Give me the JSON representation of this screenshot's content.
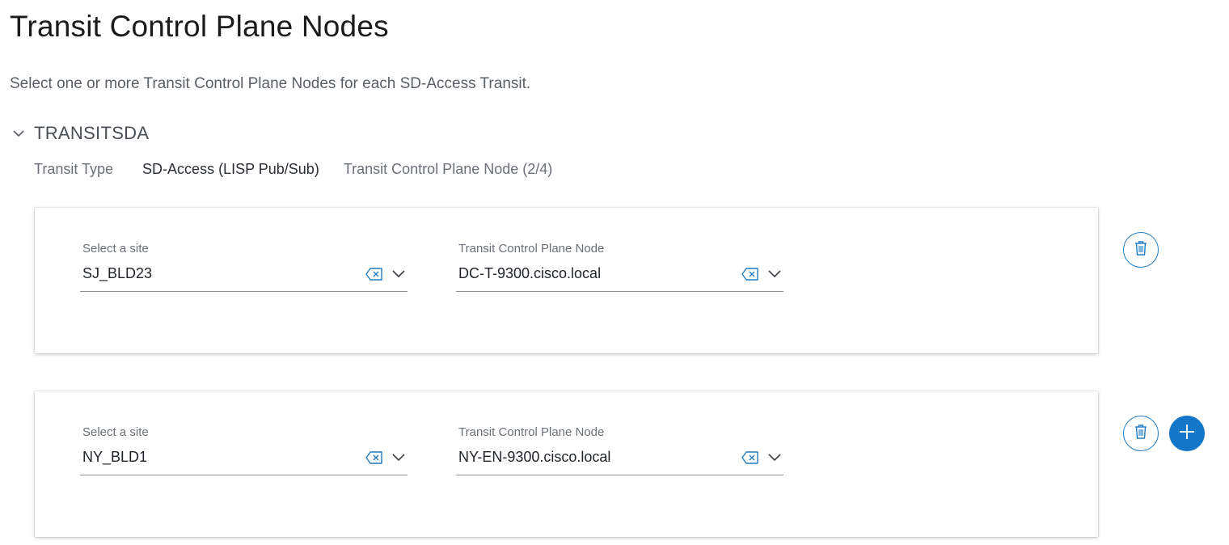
{
  "page": {
    "title": "Transit Control Plane Nodes",
    "subtitle": "Select one or more Transit Control Plane Nodes for each SD-Access Transit."
  },
  "section": {
    "title": "TRANSITSDA",
    "transit_type_label": "Transit Type",
    "transit_type_value": "SD-Access (LISP Pub/Sub)",
    "node_count_label": "Transit Control Plane Node (2/4)"
  },
  "rows": [
    {
      "site_label": "Select a site",
      "site_value": "SJ_BLD23",
      "node_label": "Transit Control Plane Node",
      "node_value": "DC-T-9300.cisco.local"
    },
    {
      "site_label": "Select a site",
      "site_value": "NY_BLD1",
      "node_label": "Transit Control Plane Node",
      "node_value": "NY-EN-9300.cisco.local"
    }
  ],
  "icons": {
    "section_toggle": "chevron-down-icon",
    "clear": "clear-input-icon",
    "dropdown": "chevron-down-icon",
    "delete": "trash-icon",
    "add": "plus-icon"
  },
  "colors": {
    "accent": "#1476c6",
    "outline": "#1f7cc2"
  }
}
